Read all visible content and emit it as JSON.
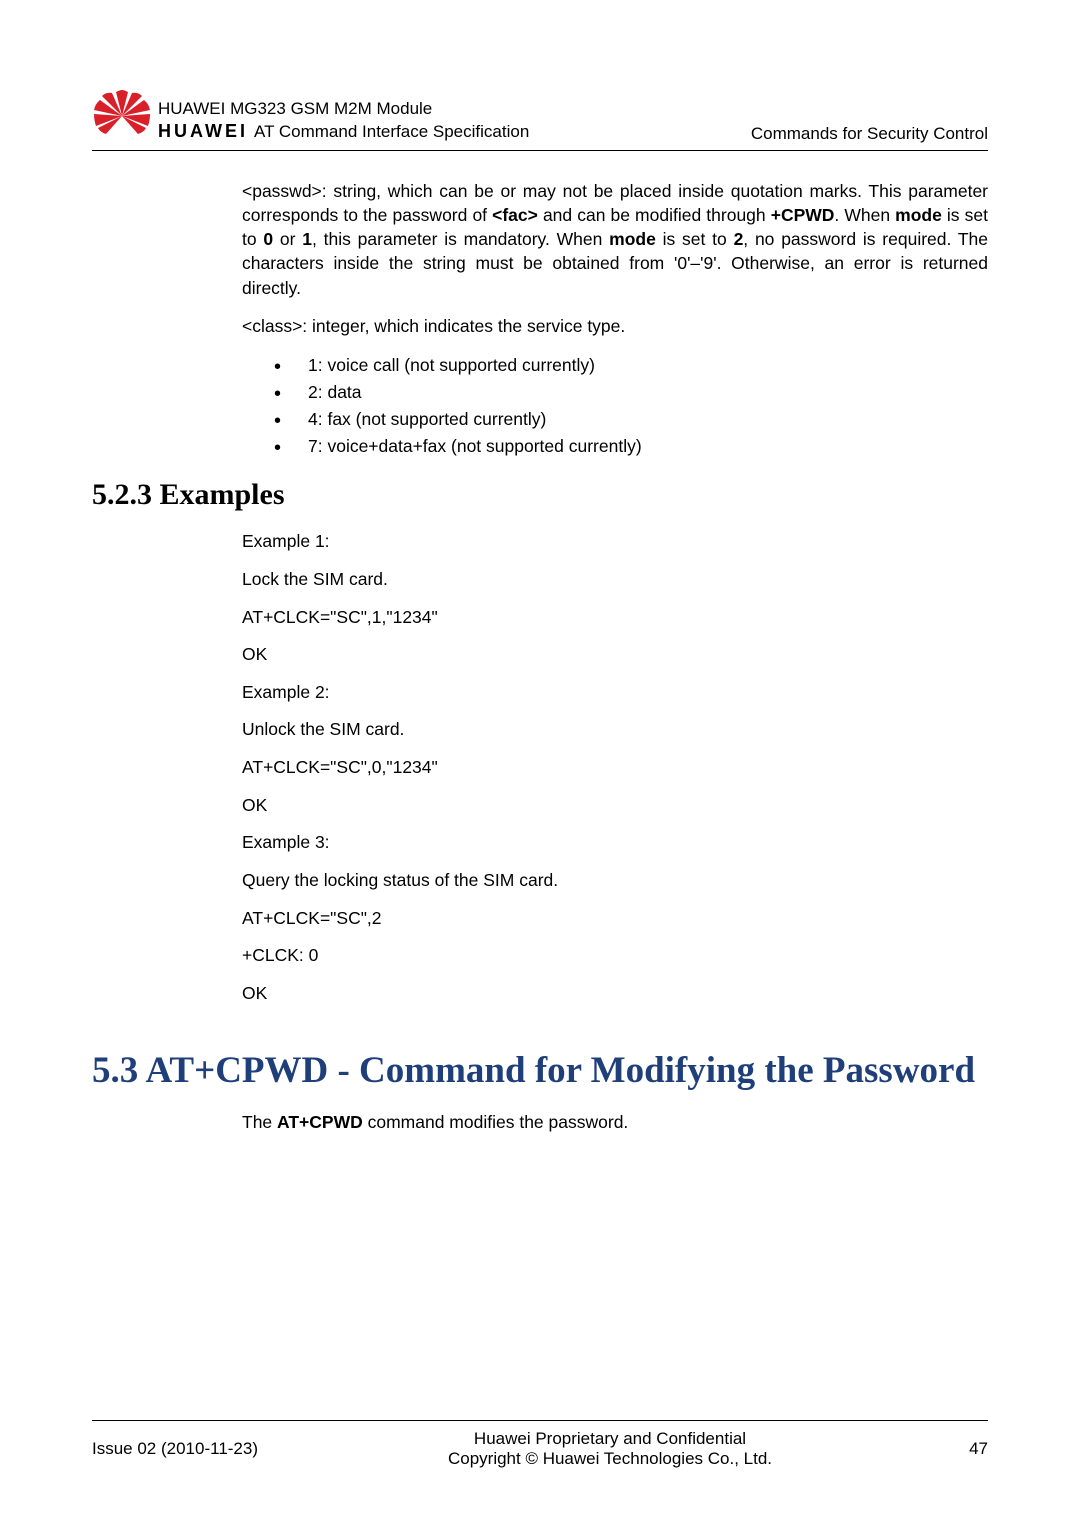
{
  "header": {
    "brand": "HUAWEI",
    "title1": "HUAWEI MG323 GSM M2M Module",
    "title2": "AT Command Interface Specification",
    "right": "Commands for Security Control"
  },
  "passwd_para_1": "<passwd>: string, which can be or may not be placed inside quotation marks. This parameter corresponds to the password of ",
  "passwd_fac": "<fac>",
  "passwd_para_2": " and can be modified through ",
  "passwd_cpwd": "+CPWD",
  "passwd_para_3": ". When ",
  "passwd_mode1": "mode",
  "passwd_para_4": " is set to ",
  "passwd_0": "0",
  "passwd_para_5": " or ",
  "passwd_1": "1",
  "passwd_para_6": ", this parameter is mandatory. When ",
  "passwd_mode2": "mode",
  "passwd_para_7": " is set to ",
  "passwd_2": "2",
  "passwd_para_8": ", no password is required. The characters inside the string must be obtained from '0'–'9'. Otherwise, an error is returned directly.",
  "class_para": "<class>: integer, which indicates the service type.",
  "bullets": {
    "b1": "1:   voice call (not supported currently)",
    "b2": "2:   data",
    "b3": "4:   fax (not supported currently)",
    "b4": "7:   voice+data+fax (not supported currently)"
  },
  "h3": "5.2.3 Examples",
  "ex": {
    "l1": "Example 1:",
    "l2": "Lock the SIM card.",
    "l3": "AT+CLCK=\"SC\",1,\"1234\"",
    "l4": "OK",
    "l5": "Example 2:",
    "l6": "Unlock the SIM card.",
    "l7": "AT+CLCK=\"SC\",0,\"1234\"",
    "l8": "OK",
    "l9": "Example 3:",
    "l10": "Query the locking status of the SIM card.",
    "l11": "AT+CLCK=\"SC\",2",
    "l12": "+CLCK: 0",
    "l13": "OK"
  },
  "h2": "5.3 AT+CPWD - Command for Modifying the Password",
  "cpwd_para_1": "The ",
  "cpwd_bold": "AT+CPWD",
  "cpwd_para_2": " command modifies the password.",
  "footer": {
    "left": "Issue 02 (2010-11-23)",
    "center1": "Huawei Proprietary and Confidential",
    "center2": "Copyright © Huawei Technologies Co., Ltd.",
    "right": "47"
  }
}
